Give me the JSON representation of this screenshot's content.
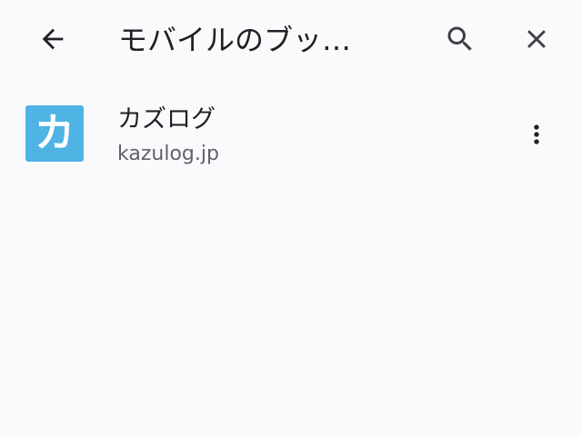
{
  "toolbar": {
    "title": "モバイルのブッ…",
    "back_icon": "arrow-back-icon",
    "search_icon": "search-icon",
    "close_icon": "close-icon"
  },
  "bookmarks": [
    {
      "favicon_glyph": "カ",
      "favicon_color": "#4fb3e4",
      "title": "カズログ",
      "url": "kazulog.jp",
      "menu_icon": "more-vert-icon"
    }
  ]
}
